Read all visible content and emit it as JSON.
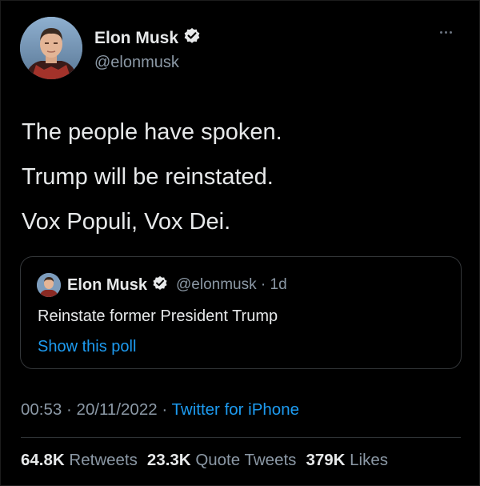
{
  "author": {
    "name": "Elon Musk",
    "handle": "@elonmusk"
  },
  "tweet": {
    "lines": [
      "The people have spoken.",
      "Trump will be reinstated.",
      "Vox Populi, Vox Dei."
    ]
  },
  "quoted_tweet": {
    "name": "Elon Musk",
    "handle": "@elonmusk",
    "age": "1d",
    "text": "Reinstate former President Trump",
    "link_text": "Show this poll"
  },
  "meta": {
    "time": "00:53",
    "date": "20/11/2022",
    "source": "Twitter for iPhone"
  },
  "stats": {
    "retweets": {
      "value": "64.8K",
      "label": "Retweets"
    },
    "quote_tweets": {
      "value": "23.3K",
      "label": "Quote Tweets"
    },
    "likes": {
      "value": "379K",
      "label": "Likes"
    }
  },
  "colors": {
    "background": "#000000",
    "text": "#e7e9ea",
    "secondary": "#8b98a5",
    "link": "#1d9bf0",
    "border": "#333639"
  },
  "icons": [
    "avatar",
    "verified-badge-icon",
    "more-icon"
  ]
}
